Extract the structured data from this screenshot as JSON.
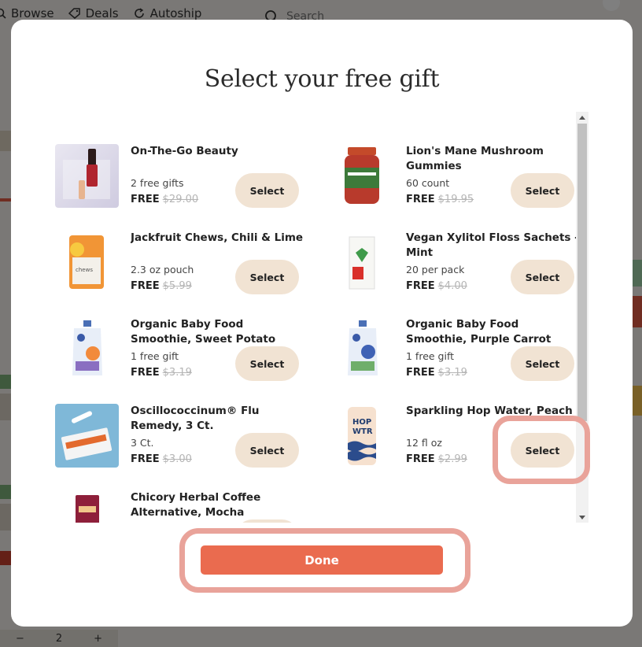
{
  "background": {
    "nav": [
      "Browse",
      "Deals",
      "Autoship"
    ],
    "search_placeholder": "Search",
    "quantity": "2",
    "minus": "−",
    "plus": "+"
  },
  "modal": {
    "title": "Select your free gift",
    "select_label": "Select",
    "free_label": "FREE",
    "done_label": "Done",
    "products": [
      {
        "name": "On-The-Go Beauty",
        "sub": "2 free gifts",
        "orig": "$29.00"
      },
      {
        "name": "Lion's Mane Mushroom Gummies",
        "sub": "60 count",
        "orig": "$19.95"
      },
      {
        "name": "Jackfruit Chews, Chili & Lime",
        "sub": "2.3 oz pouch",
        "orig": "$5.99"
      },
      {
        "name": "Vegan Xylitol Floss Sachets - Mint",
        "sub": "20 per pack",
        "orig": "$4.00"
      },
      {
        "name": "Organic Baby Food Smoothie, Sweet Potato Peach",
        "sub": "1 free gift",
        "orig": "$3.19"
      },
      {
        "name": "Organic Baby Food Smoothie, Purple Carrot Blueberry...",
        "sub": "1 free gift",
        "orig": "$3.19"
      },
      {
        "name": "Oscillococcinum® Flu Remedy, 3 Ct.",
        "sub": "3 Ct.",
        "orig": "$3.00"
      },
      {
        "name": "Sparkling Hop Water, Peach",
        "sub": "12 fl oz",
        "orig": "$2.99"
      },
      {
        "name": "Chicory Herbal Coffee Alternative, Mocha",
        "sub": "",
        "orig": ""
      }
    ]
  },
  "colors": {
    "accent": "#ea6b4f",
    "select_bg": "#f1e3d3",
    "highlight": "#e9a39a"
  }
}
